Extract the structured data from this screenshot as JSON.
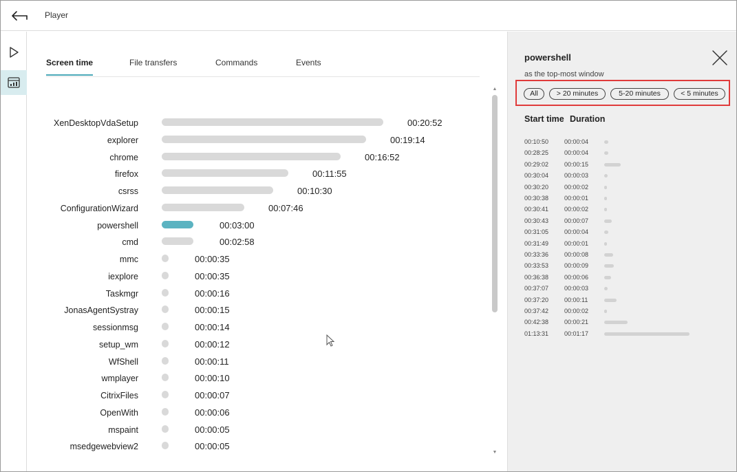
{
  "header": {
    "title": "Player"
  },
  "tabs": [
    {
      "label": "Screen time",
      "active": true
    },
    {
      "label": "File transfers",
      "active": false
    },
    {
      "label": "Commands",
      "active": false
    },
    {
      "label": "Events",
      "active": false
    }
  ],
  "apps": [
    {
      "name": "XenDesktopVdaSetup",
      "duration": "00:20:52",
      "seconds": 1252,
      "selected": false
    },
    {
      "name": "explorer",
      "duration": "00:19:14",
      "seconds": 1154,
      "selected": false
    },
    {
      "name": "chrome",
      "duration": "00:16:52",
      "seconds": 1012,
      "selected": false
    },
    {
      "name": "firefox",
      "duration": "00:11:55",
      "seconds": 715,
      "selected": false
    },
    {
      "name": "csrss",
      "duration": "00:10:30",
      "seconds": 630,
      "selected": false
    },
    {
      "name": "ConfigurationWizard",
      "duration": "00:07:46",
      "seconds": 466,
      "selected": false
    },
    {
      "name": "powershell",
      "duration": "00:03:00",
      "seconds": 180,
      "selected": true
    },
    {
      "name": "cmd",
      "duration": "00:02:58",
      "seconds": 178,
      "selected": false
    },
    {
      "name": "mmc",
      "duration": "00:00:35",
      "seconds": 35,
      "selected": false
    },
    {
      "name": "iexplore",
      "duration": "00:00:35",
      "seconds": 35,
      "selected": false
    },
    {
      "name": "Taskmgr",
      "duration": "00:00:16",
      "seconds": 16,
      "selected": false
    },
    {
      "name": "JonasAgentSystray",
      "duration": "00:00:15",
      "seconds": 15,
      "selected": false
    },
    {
      "name": "sessionmsg",
      "duration": "00:00:14",
      "seconds": 14,
      "selected": false
    },
    {
      "name": "setup_wm",
      "duration": "00:00:12",
      "seconds": 12,
      "selected": false
    },
    {
      "name": "WfShell",
      "duration": "00:00:11",
      "seconds": 11,
      "selected": false
    },
    {
      "name": "wmplayer",
      "duration": "00:00:10",
      "seconds": 10,
      "selected": false
    },
    {
      "name": "CitrixFiles",
      "duration": "00:00:07",
      "seconds": 7,
      "selected": false
    },
    {
      "name": "OpenWith",
      "duration": "00:00:06",
      "seconds": 6,
      "selected": false
    },
    {
      "name": "mspaint",
      "duration": "00:00:05",
      "seconds": 5,
      "selected": false
    },
    {
      "name": "msedgewebview2",
      "duration": "00:00:05",
      "seconds": 5,
      "selected": false
    }
  ],
  "panel": {
    "title": "powershell",
    "subtitle": "as the top-most window",
    "filters": [
      "All",
      "> 20 minutes",
      "5-20 minutes",
      "< 5 minutes"
    ],
    "col_start": "Start time",
    "col_duration": "Duration",
    "records": [
      {
        "start": "00:10:50",
        "duration": "00:00:04",
        "seconds": 4
      },
      {
        "start": "00:28:25",
        "duration": "00:00:04",
        "seconds": 4
      },
      {
        "start": "00:29:02",
        "duration": "00:00:15",
        "seconds": 15
      },
      {
        "start": "00:30:04",
        "duration": "00:00:03",
        "seconds": 3
      },
      {
        "start": "00:30:20",
        "duration": "00:00:02",
        "seconds": 2
      },
      {
        "start": "00:30:38",
        "duration": "00:00:01",
        "seconds": 1
      },
      {
        "start": "00:30:41",
        "duration": "00:00:02",
        "seconds": 2
      },
      {
        "start": "00:30:43",
        "duration": "00:00:07",
        "seconds": 7
      },
      {
        "start": "00:31:05",
        "duration": "00:00:04",
        "seconds": 4
      },
      {
        "start": "00:31:49",
        "duration": "00:00:01",
        "seconds": 1
      },
      {
        "start": "00:33:36",
        "duration": "00:00:08",
        "seconds": 8
      },
      {
        "start": "00:33:53",
        "duration": "00:00:09",
        "seconds": 9
      },
      {
        "start": "00:36:38",
        "duration": "00:00:06",
        "seconds": 6
      },
      {
        "start": "00:37:07",
        "duration": "00:00:03",
        "seconds": 3
      },
      {
        "start": "00:37:20",
        "duration": "00:00:11",
        "seconds": 11
      },
      {
        "start": "00:37:42",
        "duration": "00:00:02",
        "seconds": 2
      },
      {
        "start": "00:42:38",
        "duration": "00:00:21",
        "seconds": 21
      },
      {
        "start": "01:13:31",
        "duration": "00:01:17",
        "seconds": 77
      }
    ]
  },
  "colors": {
    "accent": "#5bb3c1",
    "bar": "#d9d9d9",
    "highlight_border": "#e03a3a",
    "panel_bg": "#efefef"
  }
}
